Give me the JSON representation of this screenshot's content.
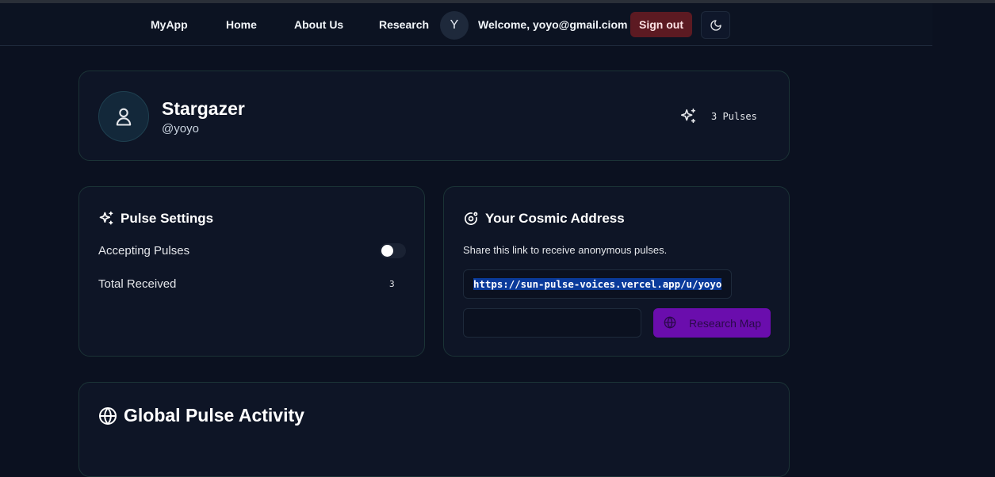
{
  "nav": {
    "brand": "MyApp",
    "links": [
      "Home",
      "About Us",
      "Research"
    ],
    "avatar_initial": "Y",
    "welcome": "Welcome, yoyo@gmail.ciom",
    "sign_out": "Sign out",
    "theme_icon": "moon-icon"
  },
  "profile": {
    "name": "Stargazer",
    "handle": "@yoyo",
    "pulses": "3 Pulses",
    "avatar_icon": "user-icon",
    "pulses_icon": "sparkles-icon"
  },
  "settings": {
    "title": "Pulse Settings",
    "title_icon": "sparkles-icon",
    "accepting_label": "Accepting Pulses",
    "accepting_enabled": false,
    "total_label": "Total Received",
    "total_value": "3"
  },
  "cosmic": {
    "title": "Your Cosmic Address",
    "title_icon": "orbit-icon",
    "description": "Share this link to receive anonymous pulses.",
    "link": "https://sun-pulse-voices.vercel.app/u/yoyo",
    "secondary_value": "",
    "button_label": "Research Map",
    "button_icon": "globe-icon"
  },
  "activity": {
    "title": "Global Pulse Activity",
    "title_icon": "globe-icon"
  },
  "colors": {
    "background": "#0b1120",
    "card_border": "#1b3336",
    "sign_out_bg": "#5c1a22",
    "button_purple": "#6a0dad",
    "selection_blue": "#0a3a9a"
  }
}
